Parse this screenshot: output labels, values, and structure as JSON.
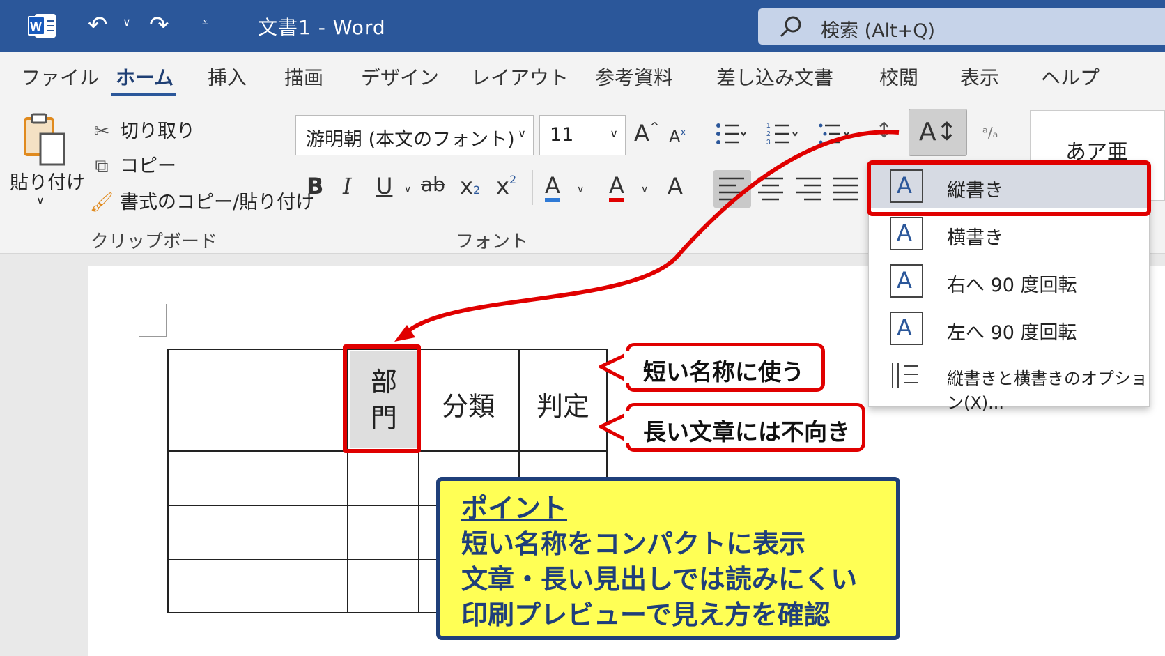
{
  "app": {
    "title": "文書1  -  Word",
    "search_placeholder": "検索 (Alt+Q)"
  },
  "tabs": [
    {
      "label": "ファイル",
      "active": false
    },
    {
      "label": "ホーム",
      "active": true
    },
    {
      "label": "挿入",
      "active": false
    },
    {
      "label": "描画",
      "active": false
    },
    {
      "label": "デザイン",
      "active": false
    },
    {
      "label": "レイアウト",
      "active": false
    },
    {
      "label": "参考資料",
      "active": false
    },
    {
      "label": "差し込み文書",
      "active": false
    },
    {
      "label": "校閲",
      "active": false
    },
    {
      "label": "表示",
      "active": false
    },
    {
      "label": "ヘルプ",
      "active": false
    }
  ],
  "clipboard": {
    "paste": "貼り付け",
    "cut": "切り取り",
    "copy": "コピー",
    "format_painter": "書式のコピー/貼り付け",
    "group": "クリップボード"
  },
  "font": {
    "name": "游明朝 (本文のフォント)",
    "size": "11",
    "group": "フォント",
    "buttons": {
      "bold": "B",
      "italic": "I",
      "underline": "U",
      "strike": "ab",
      "sub": "x",
      "sup": "x",
      "color_a": "A",
      "grow": "A",
      "shrink": "A"
    }
  },
  "styles": {
    "preview": "あア亜"
  },
  "text_direction_menu": {
    "button": "A↕",
    "items": [
      {
        "label": "縦書き",
        "icon": "vertical-text-icon",
        "selected": true
      },
      {
        "label": "横書き",
        "icon": "horizontal-text-icon",
        "selected": false
      },
      {
        "label": "右へ 90 度回転",
        "icon": "rotate-right-icon",
        "selected": false
      },
      {
        "label": "左へ 90 度回転",
        "icon": "rotate-left-icon",
        "selected": false
      },
      {
        "label": "縦書きと横書きのオプション(X)...",
        "icon": "text-direction-options-icon",
        "selected": false
      }
    ]
  },
  "document": {
    "table_headers": [
      "",
      "部門",
      "分類",
      "判定"
    ],
    "vertical_cell": "部門"
  },
  "callouts": {
    "short": "短い名称に使う",
    "long": "長い文章には不向き"
  },
  "point": {
    "title": "ポイント",
    "lines": [
      "短い名称をコンパクトに表示",
      "文章・長い見出しでは読みにくい",
      "印刷プレビューで見え方を確認"
    ]
  },
  "colors": {
    "title_bar": "#2b579a",
    "highlight_red": "#e00000",
    "point_bg": "#ffff55",
    "point_text": "#1f3f7a"
  }
}
